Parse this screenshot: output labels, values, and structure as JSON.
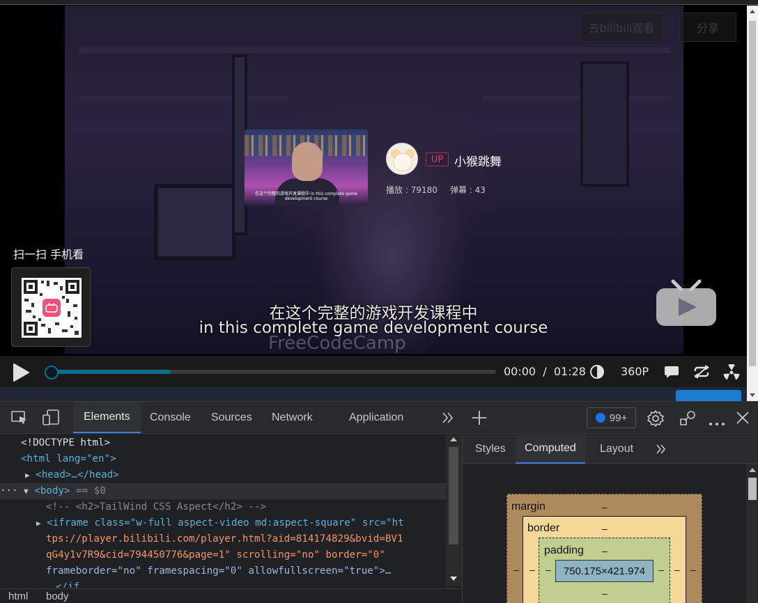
{
  "player": {
    "buttons": {
      "watch_on_bilibili": "去bilibili观看",
      "share": "分享"
    },
    "uploader": {
      "badge": "UP",
      "name": "小猴跳舞",
      "plays": "播放 : 79180",
      "danmaku": "弹幕 : 43"
    },
    "thumbnail_caption": "在这个完整的游戏开发课程中 in this complete game development course",
    "qr": {
      "label": "扫一扫 手机看"
    },
    "subtitles": {
      "cn": "在这个完整的游戏开发课程中",
      "en": "in this complete game development course"
    },
    "watermark": "FreeCodeCamp",
    "controls": {
      "time": "00:00  /  01:28",
      "quality": "360P",
      "progress": 0.28,
      "icons": [
        "play-icon",
        "volume-icon",
        "danmaku-icon",
        "loop-icon",
        "radiation-icon"
      ]
    }
  },
  "devtools": {
    "tabs": [
      "Elements",
      "Console",
      "Sources",
      "Network",
      "Application"
    ],
    "active_tab": "Elements",
    "issues_count": "99+",
    "dom": {
      "doctype": "<!DOCTYPE html>",
      "html_open": "<html lang=\"en\">",
      "head": "<head>…</head>",
      "body": "<body>",
      "body_marker": "== $0",
      "comment": "<!-- <h2>TailWind CSS Aspect</h2> -->",
      "iframe_lines": [
        "<iframe class=\"w-full aspect-video md:aspect-square\" src=\"ht",
        "tps://player.bilibili.com/player.html?aid=814174829&bvid=BV1",
        "qG4y1v7R9&cid=794450776&page=1\" scrolling=\"no\" border=\"0\"",
        "frameborder=\"no\" framespacing=\"0\" allowfullscreen=\"true\">…"
      ],
      "iframe_close": "</if"
    },
    "breadcrumb": [
      "html",
      "body"
    ],
    "side_tabs": [
      "Styles",
      "Computed",
      "Layout"
    ],
    "side_active": "Computed",
    "box_model": {
      "margin": "margin",
      "border": "border",
      "padding": "padding",
      "content": "750.175×421.974",
      "dash": "–"
    }
  }
}
